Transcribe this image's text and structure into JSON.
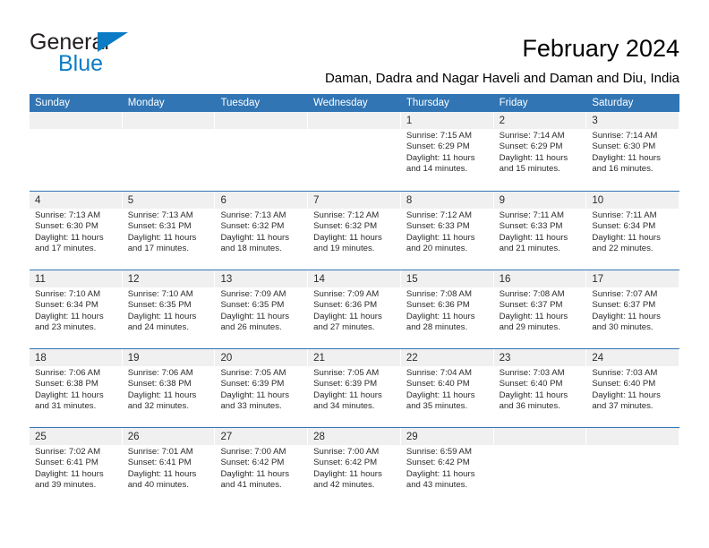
{
  "brand": {
    "name_top": "General",
    "name_bottom": "Blue",
    "triangle_color": "#0a7bc4",
    "text_color_top": "#231f20",
    "text_color_bottom": "#0d7cc6"
  },
  "header": {
    "title": "February 2024",
    "subtitle": "Daman, Dadra and Nagar Haveli and Daman and Diu, India"
  },
  "theme": {
    "header_blue": "#3175b4",
    "daynum_band": "#f0f0f0",
    "text": "#2b2b2b"
  },
  "weekdays": [
    "Sunday",
    "Monday",
    "Tuesday",
    "Wednesday",
    "Thursday",
    "Friday",
    "Saturday"
  ],
  "weeks": [
    [
      {
        "day": "",
        "sunrise": "",
        "sunset": "",
        "daylight1": "",
        "daylight2": ""
      },
      {
        "day": "",
        "sunrise": "",
        "sunset": "",
        "daylight1": "",
        "daylight2": ""
      },
      {
        "day": "",
        "sunrise": "",
        "sunset": "",
        "daylight1": "",
        "daylight2": ""
      },
      {
        "day": "",
        "sunrise": "",
        "sunset": "",
        "daylight1": "",
        "daylight2": ""
      },
      {
        "day": "1",
        "sunrise": "Sunrise: 7:15 AM",
        "sunset": "Sunset: 6:29 PM",
        "daylight1": "Daylight: 11 hours",
        "daylight2": "and 14 minutes."
      },
      {
        "day": "2",
        "sunrise": "Sunrise: 7:14 AM",
        "sunset": "Sunset: 6:29 PM",
        "daylight1": "Daylight: 11 hours",
        "daylight2": "and 15 minutes."
      },
      {
        "day": "3",
        "sunrise": "Sunrise: 7:14 AM",
        "sunset": "Sunset: 6:30 PM",
        "daylight1": "Daylight: 11 hours",
        "daylight2": "and 16 minutes."
      }
    ],
    [
      {
        "day": "4",
        "sunrise": "Sunrise: 7:13 AM",
        "sunset": "Sunset: 6:30 PM",
        "daylight1": "Daylight: 11 hours",
        "daylight2": "and 17 minutes."
      },
      {
        "day": "5",
        "sunrise": "Sunrise: 7:13 AM",
        "sunset": "Sunset: 6:31 PM",
        "daylight1": "Daylight: 11 hours",
        "daylight2": "and 17 minutes."
      },
      {
        "day": "6",
        "sunrise": "Sunrise: 7:13 AM",
        "sunset": "Sunset: 6:32 PM",
        "daylight1": "Daylight: 11 hours",
        "daylight2": "and 18 minutes."
      },
      {
        "day": "7",
        "sunrise": "Sunrise: 7:12 AM",
        "sunset": "Sunset: 6:32 PM",
        "daylight1": "Daylight: 11 hours",
        "daylight2": "and 19 minutes."
      },
      {
        "day": "8",
        "sunrise": "Sunrise: 7:12 AM",
        "sunset": "Sunset: 6:33 PM",
        "daylight1": "Daylight: 11 hours",
        "daylight2": "and 20 minutes."
      },
      {
        "day": "9",
        "sunrise": "Sunrise: 7:11 AM",
        "sunset": "Sunset: 6:33 PM",
        "daylight1": "Daylight: 11 hours",
        "daylight2": "and 21 minutes."
      },
      {
        "day": "10",
        "sunrise": "Sunrise: 7:11 AM",
        "sunset": "Sunset: 6:34 PM",
        "daylight1": "Daylight: 11 hours",
        "daylight2": "and 22 minutes."
      }
    ],
    [
      {
        "day": "11",
        "sunrise": "Sunrise: 7:10 AM",
        "sunset": "Sunset: 6:34 PM",
        "daylight1": "Daylight: 11 hours",
        "daylight2": "and 23 minutes."
      },
      {
        "day": "12",
        "sunrise": "Sunrise: 7:10 AM",
        "sunset": "Sunset: 6:35 PM",
        "daylight1": "Daylight: 11 hours",
        "daylight2": "and 24 minutes."
      },
      {
        "day": "13",
        "sunrise": "Sunrise: 7:09 AM",
        "sunset": "Sunset: 6:35 PM",
        "daylight1": "Daylight: 11 hours",
        "daylight2": "and 26 minutes."
      },
      {
        "day": "14",
        "sunrise": "Sunrise: 7:09 AM",
        "sunset": "Sunset: 6:36 PM",
        "daylight1": "Daylight: 11 hours",
        "daylight2": "and 27 minutes."
      },
      {
        "day": "15",
        "sunrise": "Sunrise: 7:08 AM",
        "sunset": "Sunset: 6:36 PM",
        "daylight1": "Daylight: 11 hours",
        "daylight2": "and 28 minutes."
      },
      {
        "day": "16",
        "sunrise": "Sunrise: 7:08 AM",
        "sunset": "Sunset: 6:37 PM",
        "daylight1": "Daylight: 11 hours",
        "daylight2": "and 29 minutes."
      },
      {
        "day": "17",
        "sunrise": "Sunrise: 7:07 AM",
        "sunset": "Sunset: 6:37 PM",
        "daylight1": "Daylight: 11 hours",
        "daylight2": "and 30 minutes."
      }
    ],
    [
      {
        "day": "18",
        "sunrise": "Sunrise: 7:06 AM",
        "sunset": "Sunset: 6:38 PM",
        "daylight1": "Daylight: 11 hours",
        "daylight2": "and 31 minutes."
      },
      {
        "day": "19",
        "sunrise": "Sunrise: 7:06 AM",
        "sunset": "Sunset: 6:38 PM",
        "daylight1": "Daylight: 11 hours",
        "daylight2": "and 32 minutes."
      },
      {
        "day": "20",
        "sunrise": "Sunrise: 7:05 AM",
        "sunset": "Sunset: 6:39 PM",
        "daylight1": "Daylight: 11 hours",
        "daylight2": "and 33 minutes."
      },
      {
        "day": "21",
        "sunrise": "Sunrise: 7:05 AM",
        "sunset": "Sunset: 6:39 PM",
        "daylight1": "Daylight: 11 hours",
        "daylight2": "and 34 minutes."
      },
      {
        "day": "22",
        "sunrise": "Sunrise: 7:04 AM",
        "sunset": "Sunset: 6:40 PM",
        "daylight1": "Daylight: 11 hours",
        "daylight2": "and 35 minutes."
      },
      {
        "day": "23",
        "sunrise": "Sunrise: 7:03 AM",
        "sunset": "Sunset: 6:40 PM",
        "daylight1": "Daylight: 11 hours",
        "daylight2": "and 36 minutes."
      },
      {
        "day": "24",
        "sunrise": "Sunrise: 7:03 AM",
        "sunset": "Sunset: 6:40 PM",
        "daylight1": "Daylight: 11 hours",
        "daylight2": "and 37 minutes."
      }
    ],
    [
      {
        "day": "25",
        "sunrise": "Sunrise: 7:02 AM",
        "sunset": "Sunset: 6:41 PM",
        "daylight1": "Daylight: 11 hours",
        "daylight2": "and 39 minutes."
      },
      {
        "day": "26",
        "sunrise": "Sunrise: 7:01 AM",
        "sunset": "Sunset: 6:41 PM",
        "daylight1": "Daylight: 11 hours",
        "daylight2": "and 40 minutes."
      },
      {
        "day": "27",
        "sunrise": "Sunrise: 7:00 AM",
        "sunset": "Sunset: 6:42 PM",
        "daylight1": "Daylight: 11 hours",
        "daylight2": "and 41 minutes."
      },
      {
        "day": "28",
        "sunrise": "Sunrise: 7:00 AM",
        "sunset": "Sunset: 6:42 PM",
        "daylight1": "Daylight: 11 hours",
        "daylight2": "and 42 minutes."
      },
      {
        "day": "29",
        "sunrise": "Sunrise: 6:59 AM",
        "sunset": "Sunset: 6:42 PM",
        "daylight1": "Daylight: 11 hours",
        "daylight2": "and 43 minutes."
      },
      {
        "day": "",
        "sunrise": "",
        "sunset": "",
        "daylight1": "",
        "daylight2": ""
      },
      {
        "day": "",
        "sunrise": "",
        "sunset": "",
        "daylight1": "",
        "daylight2": ""
      }
    ]
  ]
}
